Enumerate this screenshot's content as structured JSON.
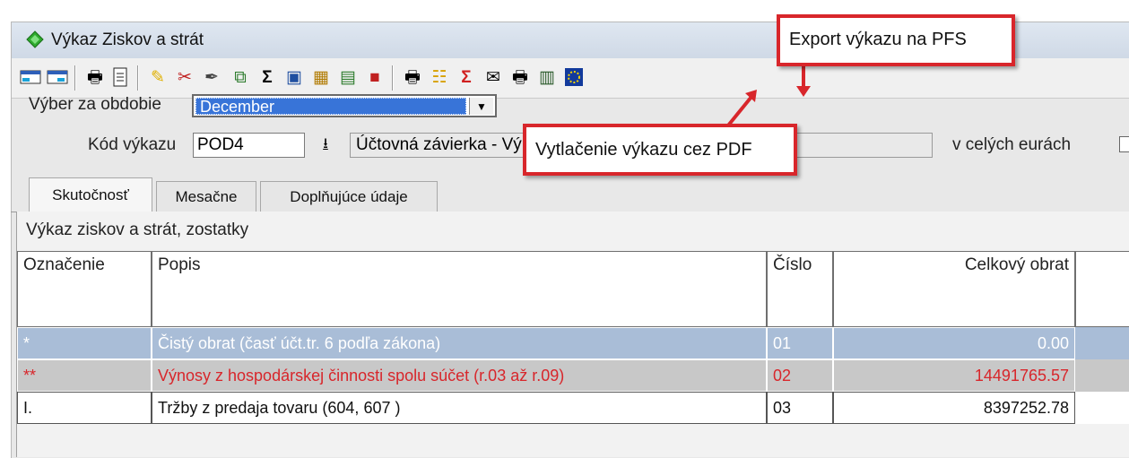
{
  "window": {
    "title": "Výkaz Ziskov a strát"
  },
  "toolbar": {
    "icons": [
      "view-icon",
      "view2-icon",
      "print-icon",
      "document-icon",
      "filter-icon",
      "tools-icon",
      "edit-icon",
      "copy-icon",
      "sum-icon",
      "book-icon",
      "calculator-icon",
      "table-icon",
      "chart-icon",
      "printer2-icon",
      "columns-icon",
      "sigma-icon",
      "mail-icon",
      "printer-pdf-icon",
      "export-pfs-icon",
      "eu-icon"
    ]
  },
  "filter": {
    "period_label": "Výber za obdobie",
    "period_value": "December",
    "code_label": "Kód výkazu",
    "code_value": "POD4",
    "code_description": "Účtovná závierka - Výkaz ziskov a strát",
    "euro_label": "v celých eurách"
  },
  "tabs": [
    {
      "label": "Skutočnosť"
    },
    {
      "label": "Mesačne"
    },
    {
      "label": "Doplňujúce údaje"
    }
  ],
  "panel": {
    "title": "Výkaz ziskov a strát, zostatky"
  },
  "table": {
    "headers": [
      "Označenie",
      "Popis",
      "Číslo",
      "Celkový obrat"
    ],
    "rows": [
      {
        "mark": "*",
        "desc": "Čistý obrat (časť účt.tr. 6 podľa zákona)",
        "num": "01",
        "total": "0.00"
      },
      {
        "mark": "**",
        "desc": "Výnosy z hospodárskej činnosti spolu súčet (r.03 až r.09)",
        "num": "02",
        "total": "14491765.57"
      },
      {
        "mark": "I.",
        "desc": "Tržby z predaja tovaru (604, 607 )",
        "num": "03",
        "total": "8397252.78"
      }
    ]
  },
  "callouts": {
    "export": "Export výkazu na PFS",
    "pdf": "Vytlačenie výkazu cez PDF"
  },
  "colors": {
    "selection": "#3874d8",
    "callout_border": "#d8262b",
    "row_selected": "#a9bdd7",
    "row_total": "#c8c8c8",
    "row_total_text": "#d8262b"
  }
}
